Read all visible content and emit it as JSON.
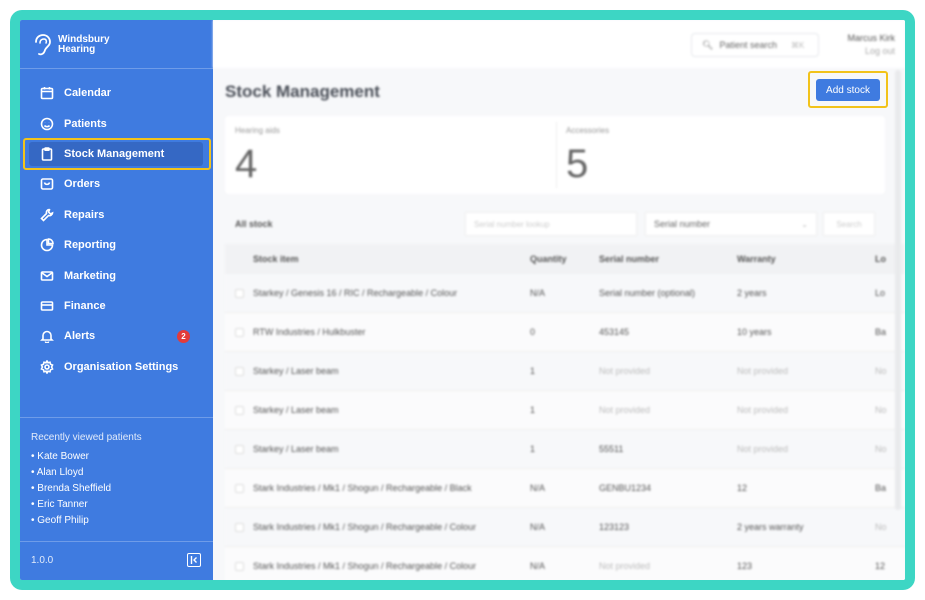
{
  "brand": {
    "line1": "Windsbury",
    "line2": "Hearing"
  },
  "nav": [
    {
      "label": "Calendar",
      "icon": "calendar-icon"
    },
    {
      "label": "Patients",
      "icon": "smile-icon"
    },
    {
      "label": "Stock Management",
      "icon": "clipboard-icon",
      "active": true
    },
    {
      "label": "Orders",
      "icon": "box-icon"
    },
    {
      "label": "Repairs",
      "icon": "wrench-icon"
    },
    {
      "label": "Reporting",
      "icon": "pie-chart-icon"
    },
    {
      "label": "Marketing",
      "icon": "mail-icon"
    },
    {
      "label": "Finance",
      "icon": "card-icon"
    },
    {
      "label": "Alerts",
      "icon": "bell-icon",
      "badge": "2"
    },
    {
      "label": "Organisation Settings",
      "icon": "gear-icon"
    }
  ],
  "recent": {
    "title": "Recently viewed patients",
    "items": [
      "• Kate Bower",
      "• Alan Lloyd",
      "• Brenda Sheffield",
      "• Eric Tanner",
      "• Geoff Philip"
    ]
  },
  "version": "1.0.0",
  "topbar": {
    "search_label": "Patient search",
    "search_kbd": "⌘K",
    "user_name": "Marcus Kirk",
    "logout": "Log out"
  },
  "page": {
    "title": "Stock Management",
    "add_label": "Add stock"
  },
  "stats": [
    {
      "label": "Hearing aids",
      "value": "4"
    },
    {
      "label": "Accessories",
      "value": "5"
    }
  ],
  "filters": {
    "all_stock": "All stock",
    "lookup_placeholder": "Serial number lookup",
    "select_value": "Serial number",
    "search_label": "Search"
  },
  "table": {
    "headers": [
      "Stock item",
      "Quantity",
      "Serial number",
      "Warranty",
      "Lo"
    ],
    "rows": [
      [
        "Starkey / Genesis 16 / RIC / Rechargeable / Colour",
        "N/A",
        "Serial number (optional)",
        "2 years",
        "Lo"
      ],
      [
        "RTW Industries / Hulkbuster",
        "0",
        "453145",
        "10 years",
        "Ba"
      ],
      [
        "Starkey / Laser beam",
        "1",
        "Not provided",
        "Not provided",
        "No"
      ],
      [
        "Starkey / Laser beam",
        "1",
        "Not provided",
        "Not provided",
        "No"
      ],
      [
        "Starkey / Laser beam",
        "1",
        "55511",
        "Not provided",
        "No"
      ],
      [
        "Stark Industries / Mk1 / Shogun / Rechargeable / Black",
        "N/A",
        "GENBU1234",
        "12",
        "Ba"
      ],
      [
        "Stark Industries / Mk1 / Shogun / Rechargeable / Colour",
        "N/A",
        "123123",
        "2 years warranty",
        "No"
      ],
      [
        "Stark Industries / Mk1 / Shogun / Rechargeable / Colour",
        "N/A",
        "Not provided",
        "123",
        "12"
      ]
    ]
  }
}
